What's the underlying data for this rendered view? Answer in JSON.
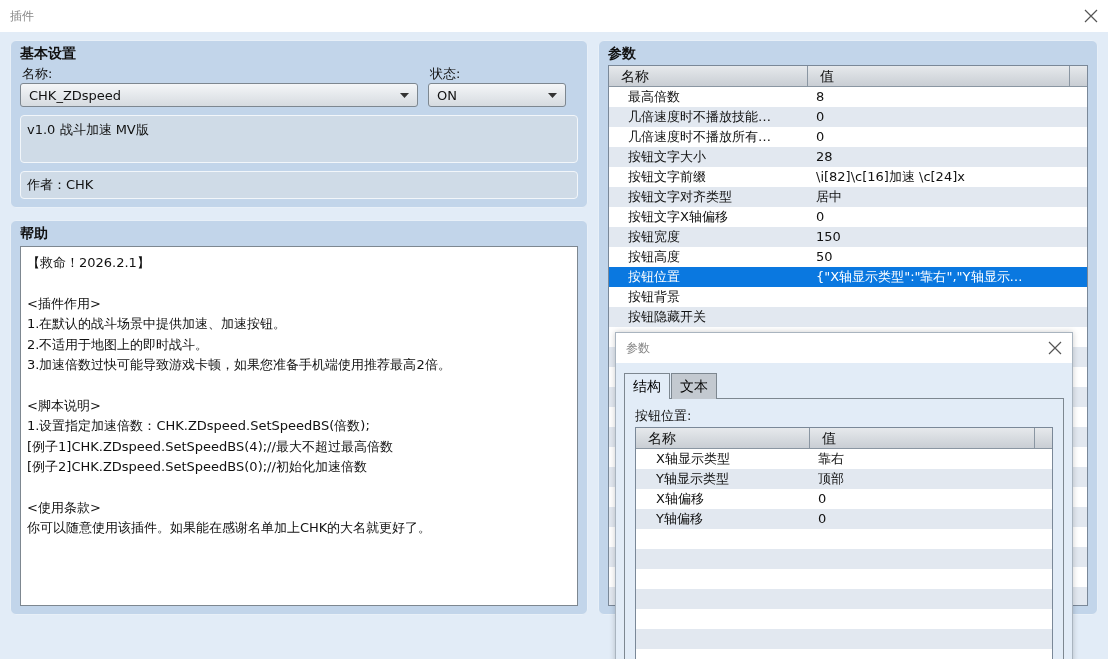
{
  "window": {
    "title": "插件"
  },
  "basic_settings": {
    "title": "基本设置",
    "name_label": "名称:",
    "name_value": "CHK_ZDspeed",
    "status_label": "状态:",
    "status_value": "ON",
    "description": "v1.0 战斗加速 MV版",
    "author": "作者：CHK"
  },
  "help": {
    "title": "帮助",
    "paragraphs": [
      [
        "【救命！2026.2.1】"
      ],
      [
        "<插件作用>",
        "1.在默认的战斗场景中提供加速、加速按钮。",
        "2.不适用于地图上的即时战斗。",
        "3.加速倍数过快可能导致游戏卡顿，如果您准备手机端使用推荐最高2倍。"
      ],
      [
        "<脚本说明>",
        "1.设置指定加速倍数：CHK.ZDspeed.SetSpeedBS(倍数);",
        "[例子1]CHK.ZDspeed.SetSpeedBS(4);//最大不超过最高倍数",
        "[例子2]CHK.ZDspeed.SetSpeedBS(0);//初始化加速倍数"
      ],
      [
        "<使用条款>",
        "你可以随意使用该插件。如果能在感谢名单加上CHK的大名就更好了。"
      ]
    ]
  },
  "parameters": {
    "title": "参数",
    "columns": [
      "名称",
      "值"
    ],
    "rows": [
      {
        "name": "最高倍数",
        "value": "8",
        "selected": false
      },
      {
        "name": "几倍速度时不播放技能…",
        "value": "0",
        "selected": false
      },
      {
        "name": "几倍速度时不播放所有…",
        "value": "0",
        "selected": false
      },
      {
        "name": "按钮文字大小",
        "value": "28",
        "selected": false
      },
      {
        "name": "按钮文字前缀",
        "value": "\\i[82]\\c[16]加速 \\c[24]x",
        "selected": false
      },
      {
        "name": "按钮文字对齐类型",
        "value": "居中",
        "selected": false
      },
      {
        "name": "按钮文字X轴偏移",
        "value": "0",
        "selected": false
      },
      {
        "name": "按钮宽度",
        "value": "150",
        "selected": false
      },
      {
        "name": "按钮高度",
        "value": "50",
        "selected": false
      },
      {
        "name": "按钮位置",
        "value": "{\"X轴显示类型\":\"靠右\",\"Y轴显示…",
        "selected": true
      },
      {
        "name": "按钮背景",
        "selected": false
      },
      {
        "name": "按钮隐藏开关",
        "selected": false
      }
    ]
  },
  "dialog": {
    "title": "参数",
    "tabs": [
      {
        "label": "结构",
        "selected": true
      },
      {
        "label": "文本",
        "selected": false
      }
    ],
    "field_label": "按钮位置:",
    "columns": [
      "名称",
      "值"
    ],
    "rows": [
      {
        "name": "X轴显示类型",
        "value": "靠右",
        "selected": false
      },
      {
        "name": "Y轴显示类型",
        "value": "顶部",
        "selected": false
      },
      {
        "name": "X轴偏移",
        "value": "0",
        "selected": false
      },
      {
        "name": "Y轴偏移",
        "value": "0",
        "selected": false
      }
    ]
  }
}
